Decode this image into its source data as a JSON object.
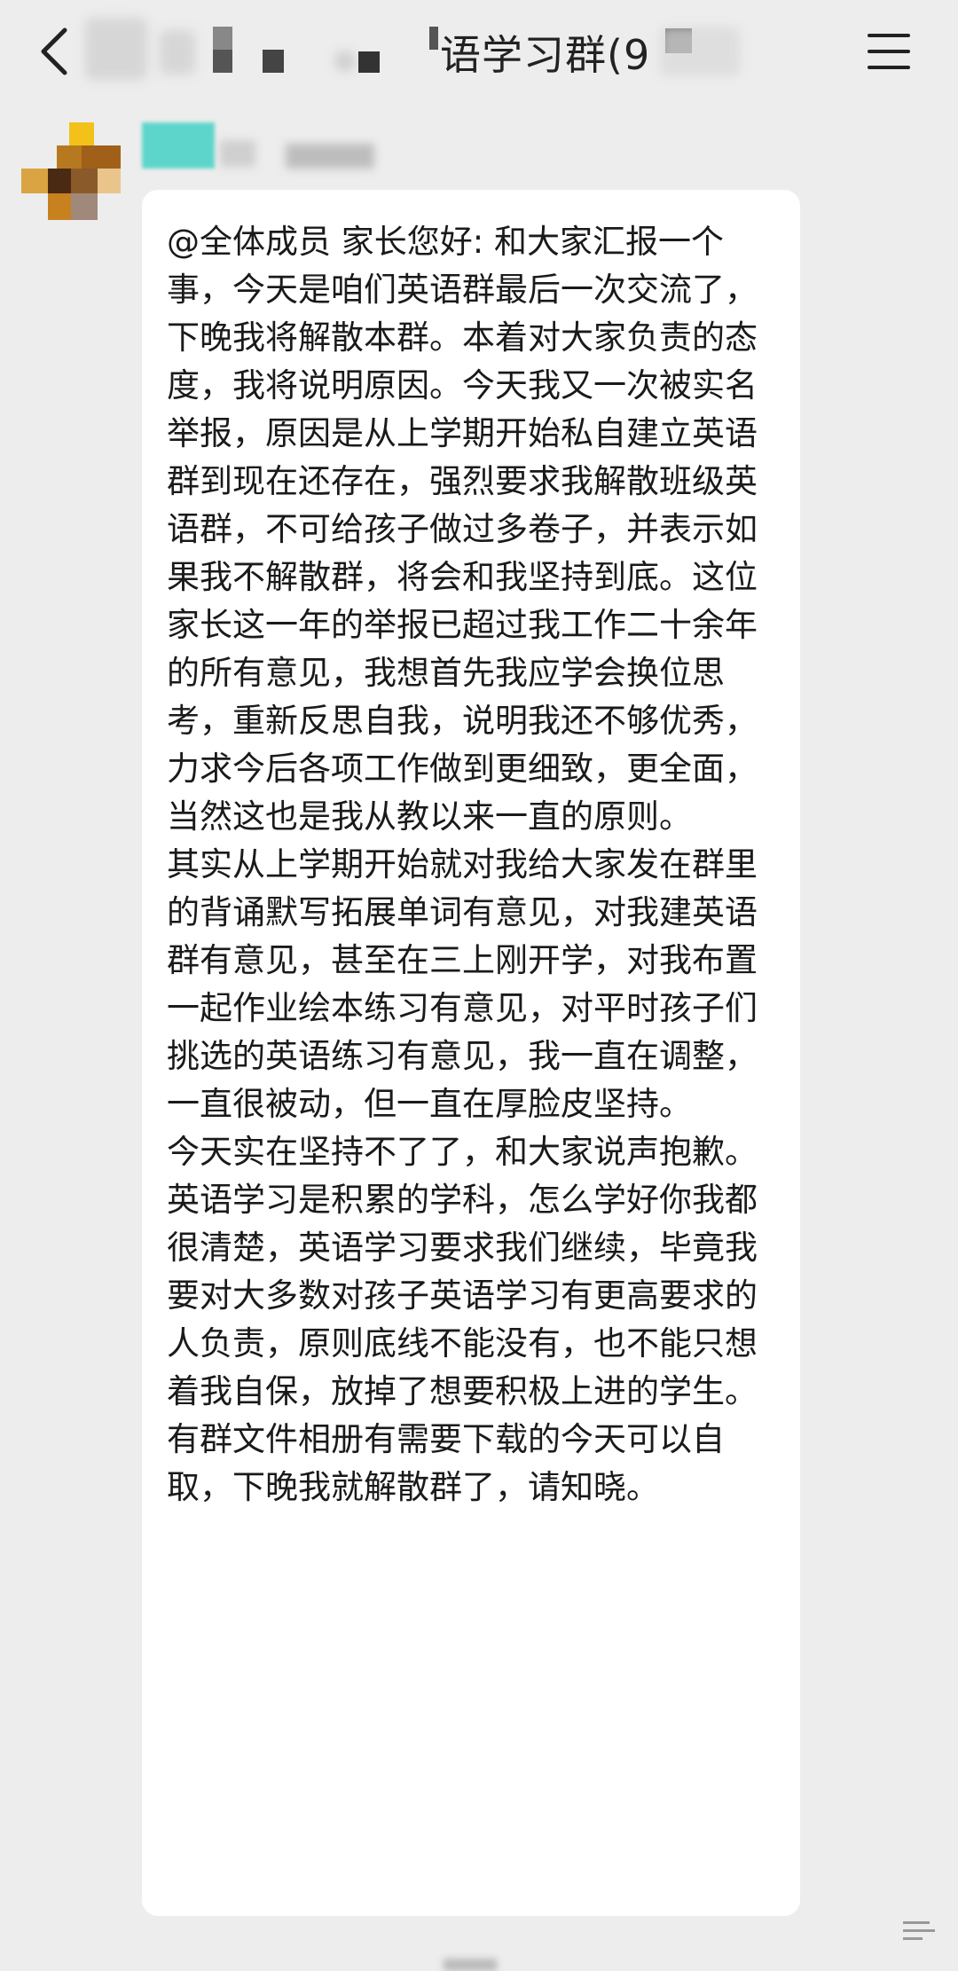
{
  "header": {
    "title": "语学习群(9",
    "back_icon": "chevron-left-icon",
    "menu_icon": "hamburger-menu-icon"
  },
  "message": {
    "paragraphs": [
      "@全体成员 家长您好: 和大家汇报一个事，今天是咱们英语群最后一次交流了，下晚我将解散本群。本着对大家负责的态度，我将说明原因。今天我又一次被实名举报，原因是从上学期开始私自建立英语群到现在还存在，强烈要求我解散班级英语群，不可给孩子做过多卷子，并表示如果我不解散群，将会和我坚持到底。这位家长这一年的举报已超过我工作二十余年的所有意见，我想首先我应学会换位思考，重新反思自我，说明我还不够优秀，力求今后各项工作做到更细致，更全面，当然这也是我从教以来一直的原则。",
      "其实从上学期开始就对我给大家发在群里的背诵默写拓展单词有意见，对我建英语群有意见，甚至在三上刚开学，对我布置一起作业绘本练习有意见，对平时孩子们挑选的英语练习有意见，我一直在调整，一直很被动，但一直在厚脸皮坚持。",
      "今天实在坚持不了了，和大家说声抱歉。英语学习是积累的学科，怎么学好你我都很清楚，英语学习要求我们继续，毕竟我要对大多数对孩子英语学习有更高要求的人负责，原则底线不能没有，也不能只想着我自保，放掉了想要积极上进的学生。",
      "有群文件相册有需要下载的今天可以自取，下晚我就解散群了，请知晓。"
    ]
  },
  "colors": {
    "background": "#ededed",
    "bubble": "#ffffff",
    "text": "#1a1a1a",
    "name_blur": "#4ed3c7"
  }
}
